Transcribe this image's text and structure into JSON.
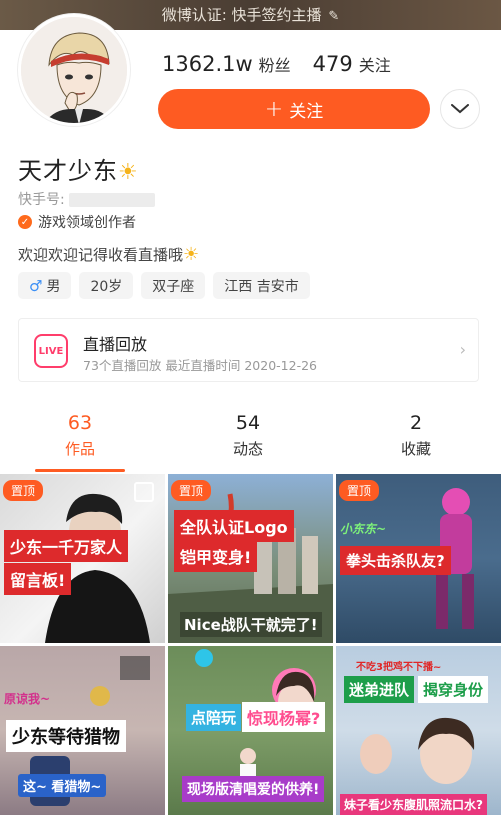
{
  "banner": {
    "label": "微博认证: 快手签约主播",
    "pen_glyph": "✎"
  },
  "profile": {
    "name": "天才少东",
    "name_emoji": "☀",
    "kuaishou_id_label": "快手号:",
    "creator_badge": "游戏领域创作者",
    "bio": "欢迎欢迎记得收看直播哦",
    "bio_emoji": "☀"
  },
  "stats": {
    "fans_value": "1362.1w",
    "fans_label": "粉丝",
    "following_value": "479",
    "following_label": "关注"
  },
  "actions": {
    "follow_label": "关注",
    "follow_plus": "+",
    "more_glyph": "﹀"
  },
  "tags": [
    {
      "icon": "♂",
      "label": "男"
    },
    {
      "label": "20岁"
    },
    {
      "label": "双子座"
    },
    {
      "label": "江西 吉安市"
    }
  ],
  "live": {
    "icon_text": "LIVE",
    "title": "直播回放",
    "subtitle": "73个直播回放  最近直播时间 2020-12-26",
    "chevron": "›"
  },
  "tabs": [
    {
      "count": "63",
      "label": "作品"
    },
    {
      "count": "54",
      "label": "动态"
    },
    {
      "count": "2",
      "label": "收藏"
    }
  ],
  "videos": [
    {
      "pinned": true,
      "pin_label": "置顶",
      "captions": [
        "少东一千万家人",
        "留言板!"
      ]
    },
    {
      "pinned": true,
      "pin_label": "置顶",
      "captions": [
        "全队认证Logo",
        "铠甲变身!",
        "Nice战队干就完了!"
      ]
    },
    {
      "pinned": true,
      "pin_label": "置顶",
      "captions": [
        "小东东~",
        "拳头击杀队友?"
      ]
    },
    {
      "pinned": false,
      "captions": [
        "原谅我~",
        "少东等待猎物",
        "这~ 看猎物~"
      ]
    },
    {
      "pinned": false,
      "captions": [
        "点陪玩",
        "惊现杨幂?",
        "现场版清唱爱的供养!"
      ]
    },
    {
      "pinned": false,
      "captions": [
        "不吃3把鸡不下播~",
        "迷弟进队",
        "揭穿身份",
        "妹子看少东腹肌照流口水?"
      ]
    }
  ],
  "colors": {
    "accent": "#fe5b22",
    "live_pink": "#ff3d6b",
    "creator_orange": "#fe6a1c",
    "caption_red": "#dd2a2c"
  }
}
